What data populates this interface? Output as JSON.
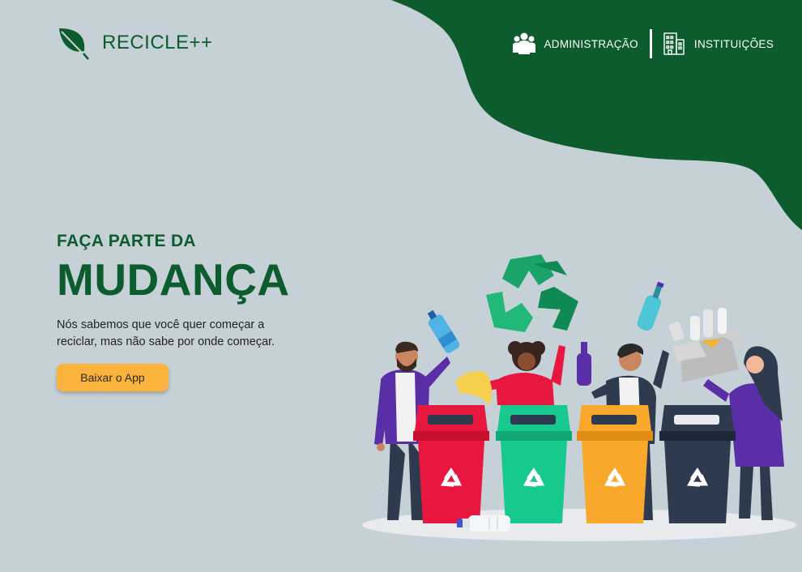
{
  "brand": {
    "name": "RECICLE++",
    "logo_icon": "leaf-icon"
  },
  "nav": {
    "items": [
      {
        "label": "ADMINISTRAÇÃO",
        "icon": "people-icon"
      },
      {
        "label": "INSTITUIÇÕES",
        "icon": "building-icon"
      }
    ]
  },
  "hero": {
    "subtitle": "FAÇA PARTE DA",
    "title": "MUDANÇA",
    "description": "Nós sabemos que você quer começar a\nreciclar, mas não sabe por onde começar.",
    "cta_label": "Baixar o App"
  },
  "colors": {
    "background": "#c6d1d7",
    "brand_green": "#0d5c2e",
    "accent": "#fbb33b",
    "bin_red": "#e8173f",
    "bin_green": "#18c98f",
    "bin_yellow": "#f9a82c",
    "bin_dark": "#2e3a4e"
  }
}
